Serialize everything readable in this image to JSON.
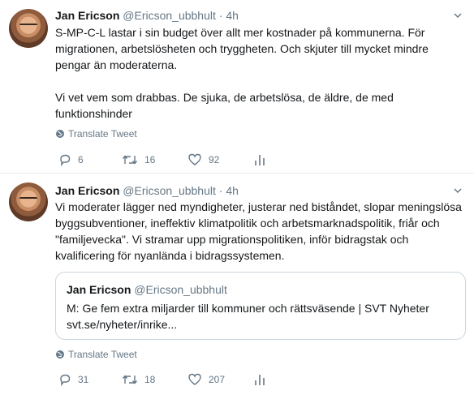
{
  "tweets": [
    {
      "author_name": "Jan Ericson",
      "handle": "@Ericson_ubbhult",
      "separator": "·",
      "time": "4h",
      "paragraphs": [
        "S-MP-C-L lastar i sin budget över allt mer kostnader på kommunerna. För migrationen, arbetslösheten och tryggheten. Och skjuter till mycket mindre pengar än moderaterna.",
        "Vi vet vem som drabbas. De sjuka, de arbetslösa, de äldre, de med funktionshinder"
      ],
      "translate_label": "Translate Tweet",
      "replies": "6",
      "retweets": "16",
      "likes": "92"
    },
    {
      "author_name": "Jan Ericson",
      "handle": "@Ericson_ubbhult",
      "separator": "·",
      "time": "4h",
      "paragraphs": [
        "Vi moderater lägger ned myndigheter, justerar ned biståndet, slopar meningslösa byggsubventioner, ineffektiv klimatpolitik och arbetsmarknadspolitik, friår och \"familjevecka\". Vi stramar upp migrationspolitiken, inför bidragstak och kvalificering för nyanlända i bidragssystemen."
      ],
      "quote": {
        "author_name": "Jan Ericson",
        "handle": "@Ericson_ubbhult",
        "text_line1": "M: Ge fem extra miljarder till kommuner och rättsväsende | SVT Nyheter",
        "text_line2": "svt.se/nyheter/inrike..."
      },
      "translate_label": "Translate Tweet",
      "replies": "31",
      "retweets": "18",
      "likes": "207"
    }
  ],
  "icons": {
    "reply": "reply-icon",
    "retweet": "retweet-icon",
    "like": "heart-icon",
    "analytics": "analytics-icon",
    "globe": "globe-icon",
    "caret": "chevron-down-icon"
  },
  "colors": {
    "text": "#14171a",
    "secondary": "#657786",
    "divider": "#e6ecf0",
    "border": "#ccd6dd"
  }
}
